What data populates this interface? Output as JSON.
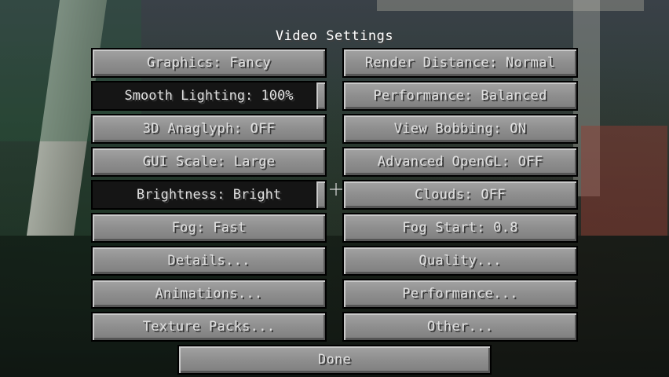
{
  "screen": {
    "title": "Video Settings"
  },
  "options": {
    "graphics": "Graphics: Fancy",
    "render_distance": "Render Distance: Normal",
    "smooth_lighting": "Smooth Lighting: 100%",
    "smooth_lighting_value": 1.0,
    "performance_mode": "Performance: Balanced",
    "anaglyph": "3D Anaglyph: OFF",
    "view_bobbing": "View Bobbing: ON",
    "gui_scale": "GUI Scale: Large",
    "advanced_opengl": "Advanced OpenGL: OFF",
    "brightness": "Brightness: Bright",
    "brightness_value": 1.0,
    "clouds": "Clouds: OFF",
    "fog": "Fog: Fast",
    "fog_start": "Fog Start: 0.8",
    "details": "Details...",
    "quality": "Quality...",
    "animations": "Animations...",
    "performance_menu": "Performance...",
    "texture_packs": "Texture Packs...",
    "other": "Other..."
  },
  "footer": {
    "done": "Done"
  }
}
